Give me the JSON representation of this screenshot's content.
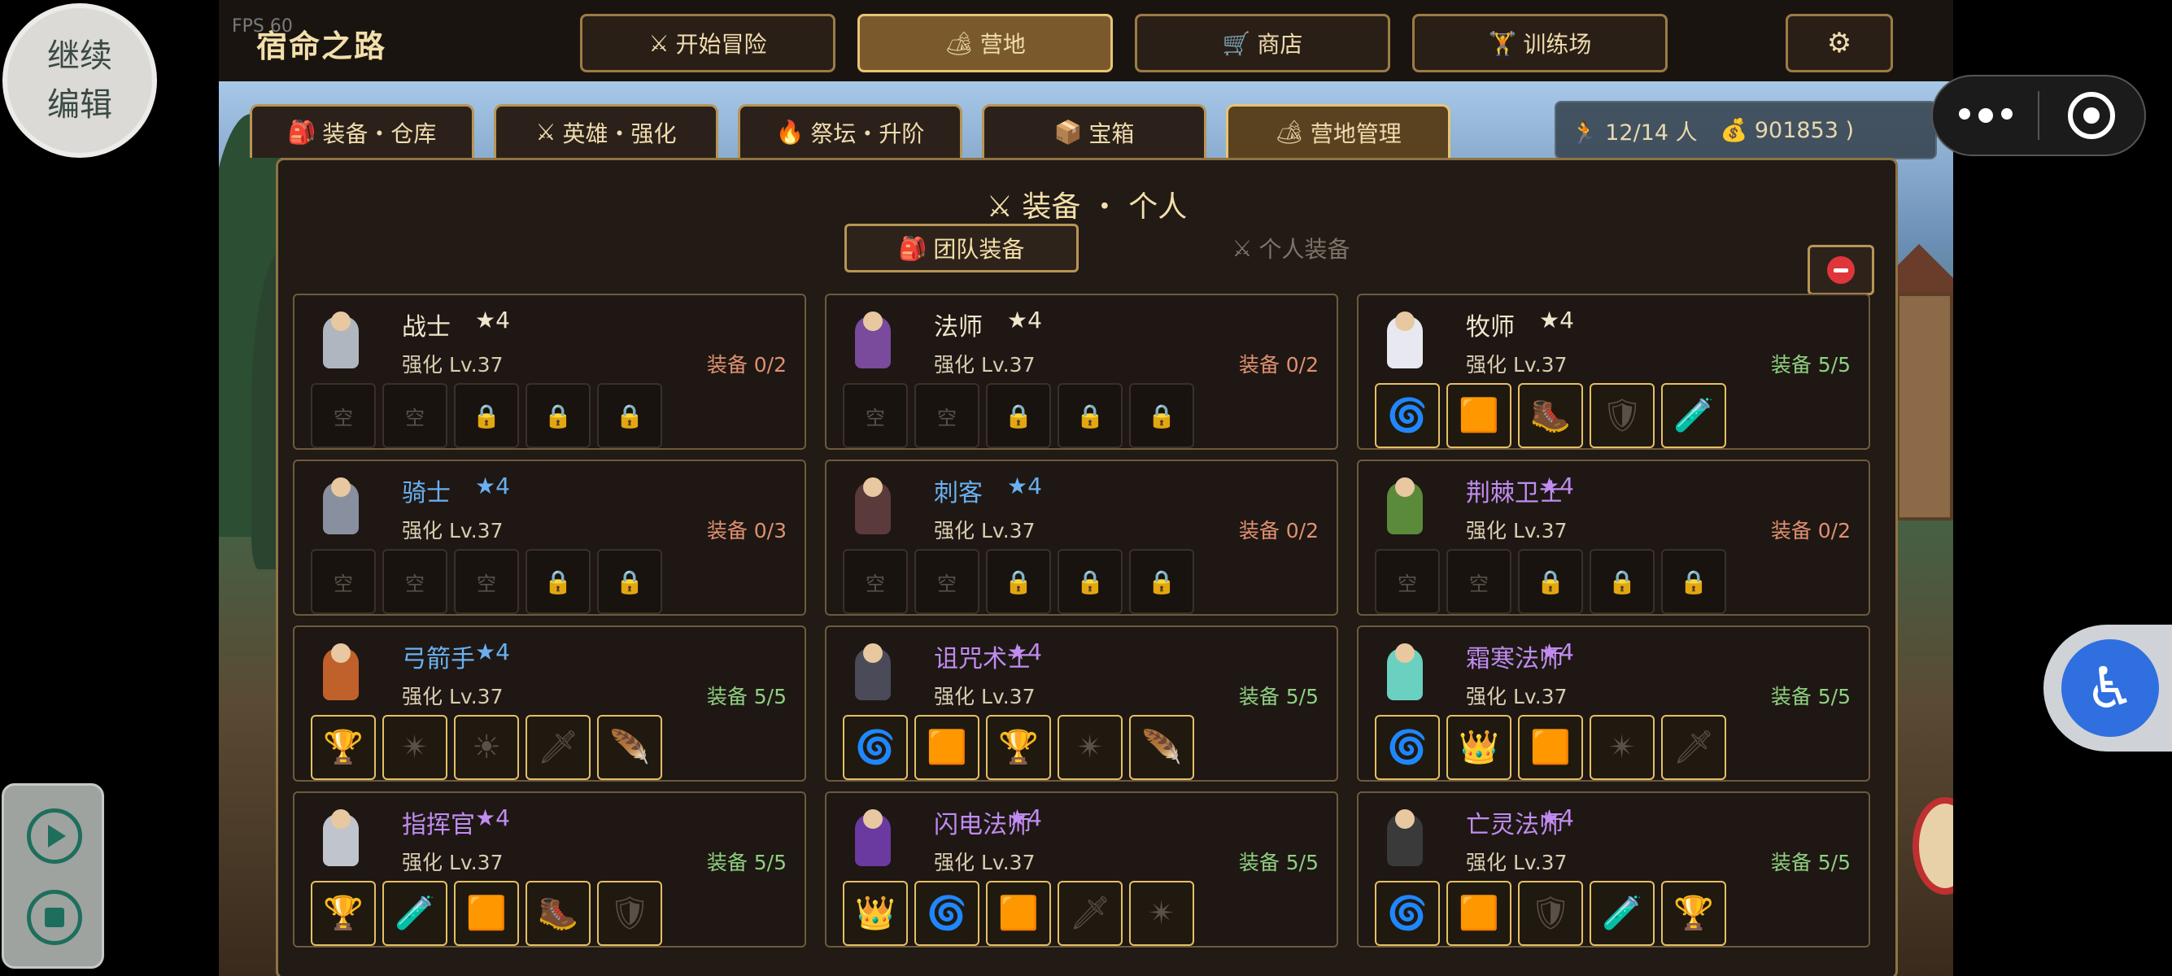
{
  "fps": "FPS 60",
  "title": "宿命之路",
  "nav": [
    {
      "icon": "⚔",
      "label": "开始冒险",
      "active": false
    },
    {
      "icon": "🏕",
      "label": "营地",
      "active": true
    },
    {
      "icon": "🛒",
      "label": "商店",
      "active": false
    },
    {
      "icon": "🏋",
      "label": "训练场",
      "active": false
    }
  ],
  "settings_icon": "⚙",
  "subtabs": [
    {
      "icon": "🎒",
      "label": "装备・仓库"
    },
    {
      "icon": "⚔",
      "label": "英雄・强化"
    },
    {
      "icon": "🔥",
      "label": "祭坛・升阶"
    },
    {
      "icon": "📦",
      "label": "宝箱"
    },
    {
      "icon": "🏕",
      "label": "营地管理"
    }
  ],
  "resources": {
    "people": "12/14 人",
    "gold": "901853 )",
    "people_icon": "🏃",
    "gold_icon": "💰"
  },
  "panel": {
    "title": "⚔ 装备 ・ 个人",
    "tab_team": "团队装备",
    "tab_team_icon": "🎒",
    "tab_personal": "个人装备",
    "tab_personal_icon": "⚔"
  },
  "heroes": [
    {
      "name": "战士",
      "star": "★4",
      "name_color": "#f0e6cc",
      "star_color": "#f0e6cc",
      "level": "强化 Lv.37",
      "equip": "装备 0/2",
      "full": false,
      "body": "#b0b6c0",
      "slots": [
        [
          "empty",
          "空"
        ],
        [
          "empty",
          "空"
        ],
        [
          "lock",
          "🔒"
        ],
        [
          "lock",
          "🔒"
        ],
        [
          "lock",
          "🔒"
        ]
      ]
    },
    {
      "name": "法师",
      "star": "★4",
      "name_color": "#f0e6cc",
      "star_color": "#f0e6cc",
      "level": "强化 Lv.37",
      "equip": "装备 0/2",
      "full": false,
      "body": "#7a4a9c",
      "slots": [
        [
          "empty",
          "空"
        ],
        [
          "empty",
          "空"
        ],
        [
          "lock",
          "🔒"
        ],
        [
          "lock",
          "🔒"
        ],
        [
          "lock",
          "🔒"
        ]
      ]
    },
    {
      "name": "牧师",
      "star": "★4",
      "name_color": "#f0e6cc",
      "star_color": "#f0e6cc",
      "level": "强化 Lv.37",
      "equip": "装备 5/5",
      "full": true,
      "body": "#e8e8f0",
      "slots": [
        [
          "item",
          "🌀"
        ],
        [
          "item",
          "🟧"
        ],
        [
          "item",
          "🥾"
        ],
        [
          "item",
          "🛡"
        ],
        [
          "item",
          "🧪"
        ]
      ]
    },
    {
      "name": "骑士",
      "star": "★4",
      "name_color": "#6ab0f0",
      "star_color": "#6ab0f0",
      "level": "强化 Lv.37",
      "equip": "装备 0/3",
      "full": false,
      "body": "#8890a0",
      "slots": [
        [
          "empty",
          "空"
        ],
        [
          "empty",
          "空"
        ],
        [
          "empty",
          "空"
        ],
        [
          "lock",
          "🔒"
        ],
        [
          "lock",
          "🔒"
        ]
      ]
    },
    {
      "name": "刺客",
      "star": "★4",
      "name_color": "#6ab0f0",
      "star_color": "#6ab0f0",
      "level": "强化 Lv.37",
      "equip": "装备 0/2",
      "full": false,
      "body": "#5a3a3a",
      "slots": [
        [
          "empty",
          "空"
        ],
        [
          "empty",
          "空"
        ],
        [
          "lock",
          "🔒"
        ],
        [
          "lock",
          "🔒"
        ],
        [
          "lock",
          "🔒"
        ]
      ]
    },
    {
      "name": "荆棘卫士",
      "star": "★4",
      "name_color": "#c08cf0",
      "star_color": "#c08cf0",
      "level": "强化 Lv.37",
      "equip": "装备 0/2",
      "full": false,
      "body": "#5a8a3a",
      "slots": [
        [
          "empty",
          "空"
        ],
        [
          "empty",
          "空"
        ],
        [
          "lock",
          "🔒"
        ],
        [
          "lock",
          "🔒"
        ],
        [
          "lock",
          "🔒"
        ]
      ]
    },
    {
      "name": "弓箭手",
      "star": "★4",
      "name_color": "#6ab0f0",
      "star_color": "#6ab0f0",
      "level": "强化 Lv.37",
      "equip": "装备 5/5",
      "full": true,
      "body": "#c0602a",
      "slots": [
        [
          "item",
          "🏆"
        ],
        [
          "item",
          "✴"
        ],
        [
          "item",
          "☀"
        ],
        [
          "item",
          "🗡"
        ],
        [
          "item",
          "🪶"
        ]
      ]
    },
    {
      "name": "诅咒术士",
      "star": "★4",
      "name_color": "#c08cf0",
      "star_color": "#c08cf0",
      "level": "强化 Lv.37",
      "equip": "装备 5/5",
      "full": true,
      "body": "#4a4a58",
      "slots": [
        [
          "item",
          "🌀"
        ],
        [
          "item",
          "🟧"
        ],
        [
          "item",
          "🏆"
        ],
        [
          "item",
          "✴"
        ],
        [
          "item",
          "🪶"
        ]
      ]
    },
    {
      "name": "霜寒法师",
      "star": "★4",
      "name_color": "#c08cf0",
      "star_color": "#c08cf0",
      "level": "强化 Lv.37",
      "equip": "装备 5/5",
      "full": true,
      "body": "#6ad0c0",
      "slots": [
        [
          "item",
          "🌀"
        ],
        [
          "item",
          "👑"
        ],
        [
          "item",
          "🟧"
        ],
        [
          "item",
          "✴"
        ],
        [
          "item",
          "🗡"
        ]
      ]
    },
    {
      "name": "指挥官",
      "star": "★4",
      "name_color": "#c08cf0",
      "star_color": "#c08cf0",
      "level": "强化 Lv.37",
      "equip": "装备 5/5",
      "full": true,
      "body": "#c0c4cc",
      "slots": [
        [
          "item",
          "🏆"
        ],
        [
          "item",
          "🧪"
        ],
        [
          "item",
          "🟧"
        ],
        [
          "item",
          "🥾"
        ],
        [
          "item",
          "🛡"
        ]
      ]
    },
    {
      "name": "闪电法师",
      "star": "★4",
      "name_color": "#c08cf0",
      "star_color": "#c08cf0",
      "level": "强化 Lv.37",
      "equip": "装备 5/5",
      "full": true,
      "body": "#6a3aa0",
      "slots": [
        [
          "item",
          "👑"
        ],
        [
          "item",
          "🌀"
        ],
        [
          "item",
          "🟧"
        ],
        [
          "item",
          "🗡"
        ],
        [
          "item",
          "✴"
        ]
      ]
    },
    {
      "name": "亡灵法师",
      "star": "★4",
      "name_color": "#c08cf0",
      "star_color": "#c08cf0",
      "level": "强化 Lv.37",
      "equip": "装备 5/5",
      "full": true,
      "body": "#3a3a3a",
      "slots": [
        [
          "item",
          "🌀"
        ],
        [
          "item",
          "🟧"
        ],
        [
          "item",
          "🛡"
        ],
        [
          "item",
          "🧪"
        ],
        [
          "item",
          "🏆"
        ]
      ]
    }
  ],
  "overlay": {
    "continue_edit": "继续\n编辑"
  }
}
